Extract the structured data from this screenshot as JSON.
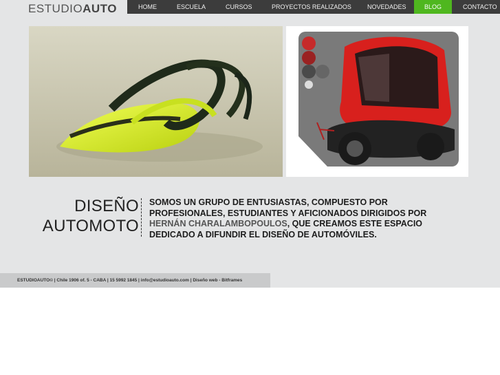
{
  "logo": {
    "part1": "ESTUDIO",
    "part2": "AUTO"
  },
  "nav": {
    "items": [
      {
        "label": "HOME",
        "active": false
      },
      {
        "label": "ESCUELA",
        "active": false
      },
      {
        "label": "CURSOS",
        "active": false
      },
      {
        "label": "PROYECTOS REALIZADOS",
        "active": false
      },
      {
        "label": "NOVEDADES",
        "active": false
      },
      {
        "label": "BLOG",
        "active": true
      },
      {
        "label": "CONTACTO",
        "active": false
      }
    ],
    "active_color": "#4fb71f",
    "bar_color": "#3c3c3c"
  },
  "heading": {
    "line1": "DISEÑO",
    "line2": "AUTOMOTO"
  },
  "intro": {
    "before": "SOMOS UN GRUPO DE ENTUSIASTAS, COMPUESTO POR PROFESIONALES, ESTUDIANTES Y AFICIONADOS DIRIGIDOS POR",
    "name": "HERNÁN CHARALAMBOPOULOS",
    "after": ", QUE CREAMOS ESTE ESPACIO DEDICADO A DIFUNDIR EL DISEÑO DE AUTOMÓVILES."
  },
  "footer": {
    "text": "ESTUDIOAUTO© | Chile 1906 of. 5 - CABA | 15 5992 1845 | info@estudioauto.com | Diseño web - Bitframes"
  },
  "colors": {
    "background": "#e4e5e6",
    "footer": "#c9cacb"
  }
}
